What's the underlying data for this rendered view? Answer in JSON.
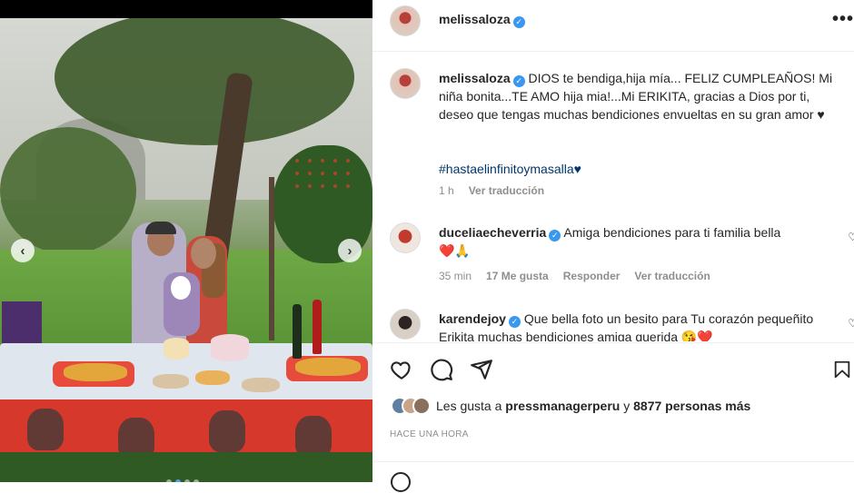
{
  "post": {
    "author": "melissaloza",
    "more_label": "•••",
    "carousel": {
      "prev": "‹",
      "next": "›",
      "dots": 4,
      "active_dot": 1
    }
  },
  "comments": [
    {
      "username": "melissaloza",
      "text": "DIOS te bendiga,hija mía... FELIZ CUMPLEAÑOS! Mi niña bonita...TE AMO hija mia!...Mi ERIKITA, gracias a Dios por ti, deseo que tengas muchas bendiciones envueltas en su gran amor ♥",
      "hashtag": "#hastaelinfinitoymasalla♥",
      "time": "1 h",
      "translate": "Ver traducción"
    },
    {
      "username": "duceliaecheverria",
      "text": "Amiga bendiciones para ti familia bella",
      "emoji": "❤️🙏",
      "time": "35 min",
      "likes": "17 Me gusta",
      "reply": "Responder",
      "translate": "Ver traducción"
    },
    {
      "username": "karendejoy",
      "text": "Que bella foto un besito para Tu corazón pequeñito Erikita muchas bendiciones amiga querida 😘❤️"
    }
  ],
  "likes": {
    "prefix": "Les gusta a ",
    "user": "pressmanagerperu",
    "connector": " y ",
    "count": "8877 personas más"
  },
  "timeago": "HACE UNA HORA",
  "icons": {
    "like": "heart-outline-icon",
    "comment": "comment-icon",
    "share": "paper-plane-icon",
    "save": "bookmark-icon"
  },
  "colors": {
    "verified": "#3897f0",
    "hashtag": "#00376b",
    "meta": "#8e8e8e"
  }
}
